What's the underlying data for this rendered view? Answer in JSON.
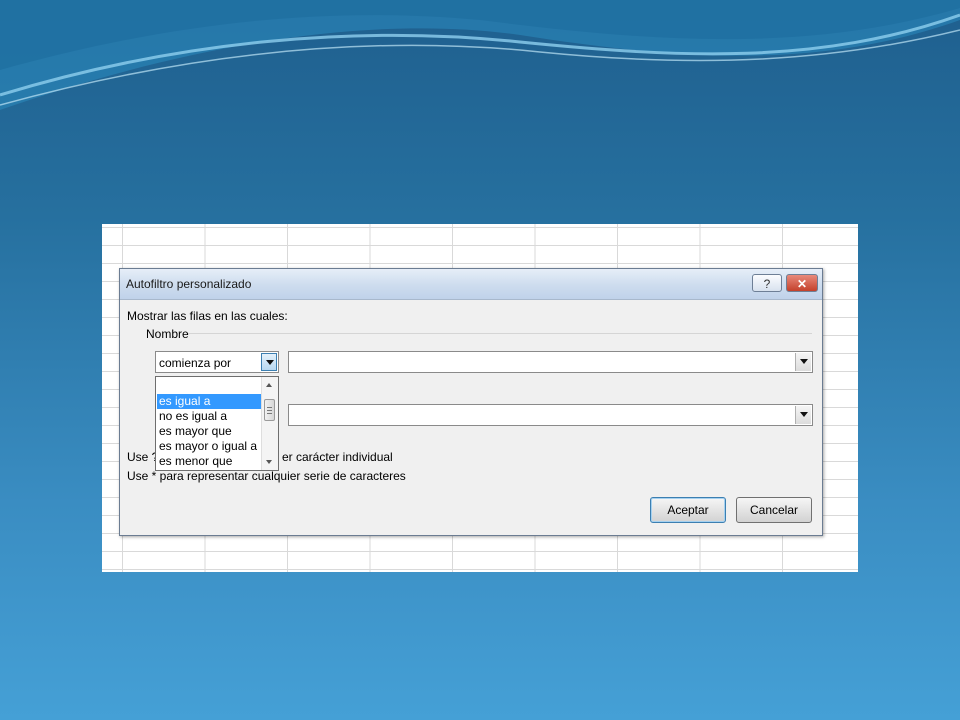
{
  "dialog": {
    "title": "Autofiltro personalizado",
    "help_label": "?",
    "close_label": "✕",
    "instruction": "Mostrar las filas en las cuales:",
    "group_label": "Nombre",
    "criterion1": {
      "operator": "comienza por",
      "value": ""
    },
    "criterion2": {
      "value": ""
    },
    "operator_options": [
      "es igual a",
      "no es igual a",
      "es mayor que",
      "es mayor o igual a",
      "es menor que"
    ],
    "selected_option": "es igual a",
    "hint1_visible_start": "Use ?",
    "hint1_visible_end": "er carácter individual",
    "hint2": "Use * para representar cualquier serie de caracteres",
    "ok_label": "Aceptar",
    "cancel_label": "Cancelar"
  },
  "icons": [
    "help-icon",
    "close-icon",
    "dropdown-arrow-icon",
    "scroll-up-icon",
    "scroll-down-icon"
  ],
  "colors": {
    "background": "#2a77ab",
    "selection": "#3399ff",
    "close_button": "#c4412c"
  }
}
